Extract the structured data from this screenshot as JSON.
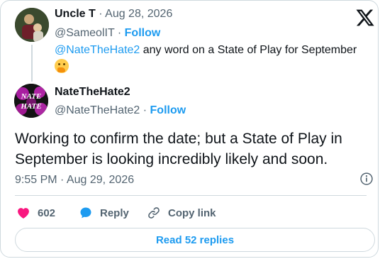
{
  "x_logo_icon": "x-logo-icon",
  "reply": {
    "display_name": "Uncle T",
    "date_sep": " · ",
    "date": "Aug 28, 2026",
    "handle": "@SameolIT",
    "follow_sep": " · ",
    "follow_label": "Follow",
    "mention": "@NateTheHate2",
    "text": " any word on a State of Play for September",
    "emoji_icon": "thinking-face-icon"
  },
  "tweet": {
    "display_name": "NateTheHate2",
    "handle": "@NateTheHate2",
    "follow_sep": " · ",
    "follow_label": "Follow",
    "avatar_text_line1": "NATE",
    "avatar_text_line2": "HATE",
    "text": "Working to confirm the date; but a State of Play in September is looking incredibly likely and soon.",
    "timestamp": "9:55 PM · Aug 29, 2026"
  },
  "actions": {
    "likes_count": "602",
    "reply_label": "Reply",
    "copy_link_label": "Copy link"
  },
  "read_replies_label": "Read 52 replies",
  "colors": {
    "accent": "#1d9bf0",
    "like": "#f91880",
    "muted": "#536471"
  }
}
